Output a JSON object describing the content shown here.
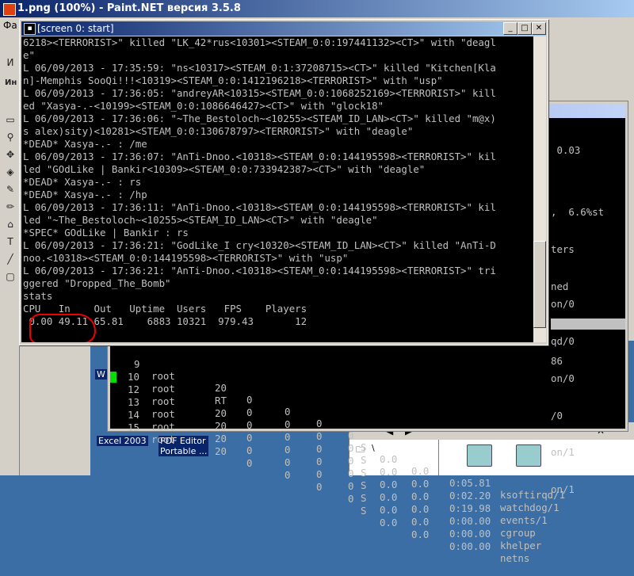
{
  "paint": {
    "title": "1.png (100%) - Paint.NET версия 3.5.8",
    "menu": [
      "Фа",
      "И"
    ],
    "side_label": "Ин"
  },
  "desktop": {
    "icons": [
      {
        "label": "Excel 2003"
      },
      {
        "label": "PDF Editor\nPortable ..."
      },
      {
        "label": "W"
      }
    ]
  },
  "explorer": {
    "tree_item": "\\"
  },
  "term_bg": {
    "top_lines": [
      " 0.03",
      "",
      ",  6.6%st",
      "ters",
      "ned",
      "",
      "86"
    ],
    "side_lines": [
      "on/0",
      "qd/0",
      "on/0",
      "/0",
      "on/1",
      "on/1"
    ],
    "processes": [
      {
        "pid": "9",
        "user": "root",
        "pr": "20",
        "ni": "0",
        "virt": "0",
        "res": "0",
        "shr": "0",
        "s": "S",
        "cpu": "0.0",
        "mem": "0.0",
        "time": "0:05.81",
        "cmd": "ksoftirqd/1"
      },
      {
        "pid": "10",
        "user": "root",
        "pr": "RT",
        "ni": "0",
        "virt": "0",
        "res": "0",
        "shr": "0",
        "s": "S",
        "cpu": "0.0",
        "mem": "0.0",
        "time": "0:02.20",
        "cmd": "watchdog/1"
      },
      {
        "pid": "12",
        "user": "root",
        "pr": "20",
        "ni": "0",
        "virt": "0",
        "res": "0",
        "shr": "0",
        "s": "S",
        "cpu": "0.0",
        "mem": "0.0",
        "time": "0:19.98",
        "cmd": "events/1"
      },
      {
        "pid": "13",
        "user": "root",
        "pr": "20",
        "ni": "0",
        "virt": "0",
        "res": "0",
        "shr": "0",
        "s": "S",
        "cpu": "0.0",
        "mem": "0.0",
        "time": "0:00.00",
        "cmd": "cgroup"
      },
      {
        "pid": "14",
        "user": "root",
        "pr": "20",
        "ni": "0",
        "virt": "0",
        "res": "0",
        "shr": "0",
        "s": "S",
        "cpu": "0.0",
        "mem": "0.0",
        "time": "0:00.00",
        "cmd": "khelper"
      },
      {
        "pid": "15",
        "user": "root",
        "pr": "20",
        "ni": "0",
        "virt": "0",
        "res": "0",
        "shr": "0",
        "s": "S",
        "cpu": "0.0",
        "mem": "0.0",
        "time": "0:00.00",
        "cmd": "netns"
      }
    ]
  },
  "terminal": {
    "title": "[screen 0: start]",
    "lines": [
      "6218><TERRORIST>\" killed \"LK_42*rus<10301><STEAM_0:0:197441132><CT>\" with \"deagl",
      "e\"",
      "L 06/09/2013 - 17:35:59: \"ns<10317><STEAM_0:1:37208715><CT>\" killed \"Kitchen[Kla",
      "n]-Memphis SooQi!!!<10319><STEAM_0:0:1412196218><TERRORIST>\" with \"usp\"",
      "L 06/09/2013 - 17:36:05: \"andreyAR<10315><STEAM_0:0:1068252169><TERRORIST>\" kill",
      "ed \"Xasya-.-<10199><STEAM_0:0:1086646427><CT>\" with \"glock18\"",
      "L 06/09/2013 - 17:36:06: \"~The_Bestoloch~<10255><STEAM_ID_LAN><CT>\" killed \"m@x)",
      "s alex)sity)<10281><STEAM_0:0:130678797><TERRORIST>\" with \"deagle\"",
      "*DEAD* Xasya-.- : /me",
      "L 06/09/2013 - 17:36:07: \"AnTi-Dnoo.<10318><STEAM_0:0:144195598><TERRORIST>\" kil",
      "led \"GOdLike | Bankir<10309><STEAM_0:0:733942387><CT>\" with \"deagle\"",
      "*DEAD* Xasya-.- : rs",
      "*DEAD* Xasya-.- : /hp",
      "L 06/09/2013 - 17:36:11: \"AnTi-Dnoo.<10318><STEAM_0:0:144195598><TERRORIST>\" kil",
      "led \"~The_Bestoloch~<10255><STEAM_ID_LAN><CT>\" with \"deagle\"",
      "*SPEC* GOdLike | Bankir : rs",
      "L 06/09/2013 - 17:36:21: \"GodLike_I cry<10320><STEAM_ID_LAN><CT>\" killed \"AnTi-D",
      "noo.<10318><STEAM_0:0:144195598><TERRORIST>\" with \"usp\"",
      "L 06/09/2013 - 17:36:21: \"AnTi-Dnoo.<10318><STEAM_0:0:144195598><TERRORIST>\" tri",
      "ggered \"Dropped_The_Bomb\"",
      "stats",
      "CPU   In    Out   Uptime  Users   FPS    Players",
      " 0.00 49.11 65.81    6883 10321  979.43       12"
    ]
  }
}
